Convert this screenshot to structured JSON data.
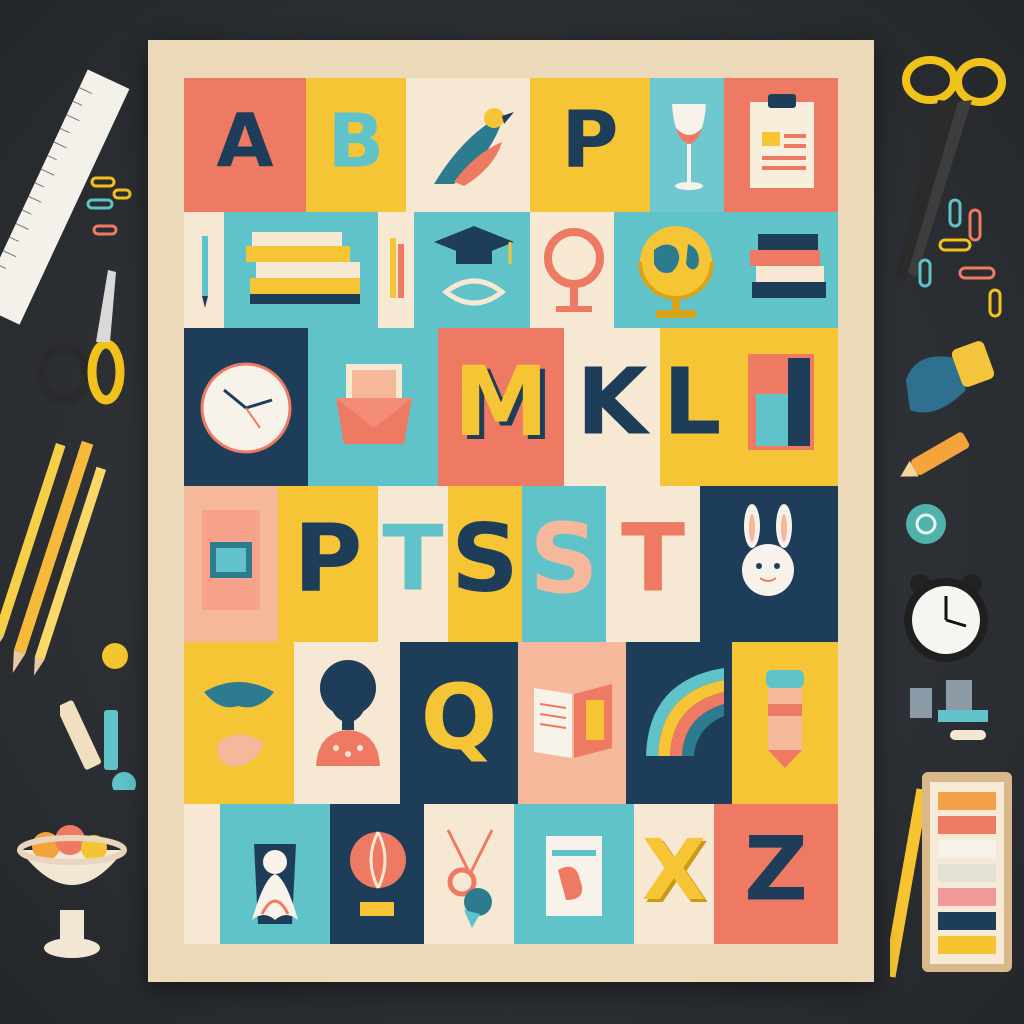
{
  "poster": {
    "row1": {
      "letters": [
        "A",
        "B",
        "P"
      ]
    },
    "row3": {
      "letters": [
        "M",
        "K",
        "L"
      ]
    },
    "row4": {
      "letters": [
        "P",
        "T",
        "S",
        "S",
        "T"
      ]
    },
    "row5": {
      "letters": [
        "Q"
      ]
    },
    "row6": {
      "letters": [
        "X",
        "Z"
      ]
    }
  },
  "colors": {
    "coral": "#ef7a63",
    "yellow": "#f5c536",
    "teal": "#5fc3c9",
    "navy": "#1e3d59",
    "cream": "#f7e8d3",
    "peach": "#f6b89a",
    "frame": "#ecd9b9",
    "desk": "#2f3236"
  },
  "icons": [
    "bird-icon",
    "wine-glass-icon",
    "clipboard-icon",
    "books-icon",
    "graduation-cap-icon",
    "magnifier-icon",
    "globe-icon",
    "book-stack-icon",
    "clock-icon",
    "envelope-icon",
    "notebook-icon",
    "bunny-icon",
    "mask-icon",
    "girl-icon",
    "open-book-icon",
    "rainbow-icon",
    "paint-tube-icon",
    "ghost-icon",
    "ball-icon",
    "scissors-icon",
    "pencil-icon",
    "ruler-icon",
    "paper-clip-icon",
    "alarm-clock-icon",
    "paint-palette-icon",
    "fruit-bowl-icon",
    "eraser-icon"
  ]
}
